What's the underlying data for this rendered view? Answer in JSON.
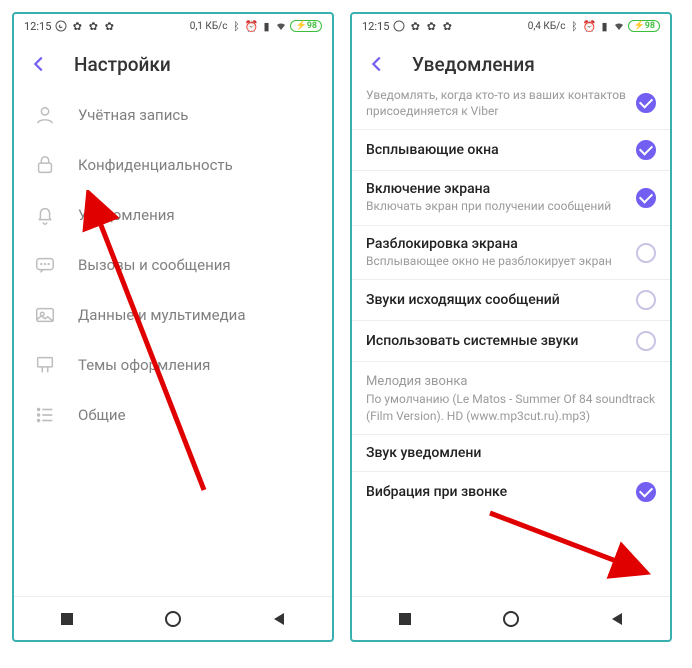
{
  "left": {
    "statusbar": {
      "time": "12:15",
      "net": "0,1 КБ/с",
      "battery": "98"
    },
    "header": {
      "title": "Настройки"
    },
    "items": [
      {
        "label": "Учётная запись",
        "icon": "user-icon"
      },
      {
        "label": "Конфиденциальность",
        "icon": "lock-icon"
      },
      {
        "label": "Уведомления",
        "icon": "bell-icon"
      },
      {
        "label": "Вызовы и сообщения",
        "icon": "chat-icon"
      },
      {
        "label": "Данные и мультимедиа",
        "icon": "media-icon"
      },
      {
        "label": "Темы оформления",
        "icon": "theme-icon"
      },
      {
        "label": "Общие",
        "icon": "list-icon"
      }
    ]
  },
  "right": {
    "statusbar": {
      "time": "12:15",
      "net": "0,4 КБ/с",
      "battery": "98"
    },
    "header": {
      "title": "Уведомления"
    },
    "rows": [
      {
        "title": "",
        "sub": "Уведомлять, когда кто-то из ваших контактов присоединяется к Viber",
        "on": true
      },
      {
        "title": "Всплывающие окна",
        "sub": "",
        "on": true
      },
      {
        "title": "Включение экрана",
        "sub": "Включать экран при получении сообщений",
        "on": true
      },
      {
        "title": "Разблокировка экрана",
        "sub": "Всплывающее окно не разблокирует экран",
        "on": false
      },
      {
        "title": "Звуки исходящих сообщений",
        "sub": "",
        "on": false
      },
      {
        "title": "Использовать системные звуки",
        "sub": "",
        "on": false
      }
    ],
    "ringtone": {
      "label": "Мелодия звонка",
      "value": "По умолчанию (Le Matos - Summer Of 84 soundtrack (Film Version). HD (www.mp3cut.ru).mp3)"
    },
    "rows2": [
      {
        "title": "Звук уведомлени",
        "on": null
      },
      {
        "title": "Вибрация при звонке",
        "on": true
      }
    ]
  }
}
